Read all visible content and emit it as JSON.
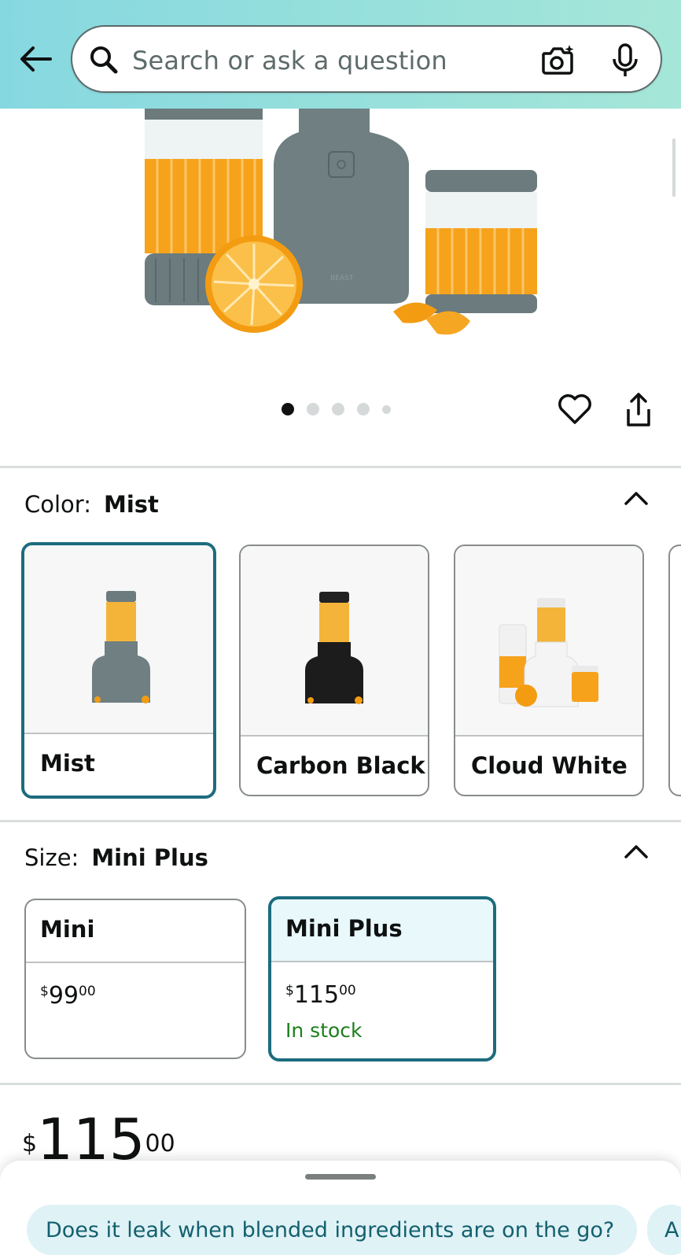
{
  "header": {
    "search_placeholder": "Search or ask a question",
    "icons": [
      "back-arrow-icon",
      "search-icon",
      "camera-icon",
      "microphone-icon"
    ]
  },
  "gallery": {
    "image_count": 5,
    "active_index": 0,
    "product_brand": "BEAST"
  },
  "color": {
    "label": "Color:",
    "selected": "Mist",
    "options": [
      {
        "label": "Mist"
      },
      {
        "label": "Carbon Black"
      },
      {
        "label": "Cloud White"
      }
    ]
  },
  "size": {
    "label": "Size:",
    "selected": "Mini Plus",
    "options": [
      {
        "label": "Mini",
        "price_currency": "$",
        "price_whole": "99",
        "price_cents": "00",
        "stock": ""
      },
      {
        "label": "Mini Plus",
        "price_currency": "$",
        "price_whole": "115",
        "price_cents": "00",
        "stock": "In stock"
      }
    ]
  },
  "price": {
    "currency": "$",
    "whole": "115",
    "cents": "00"
  },
  "suggestions": [
    "Does it leak when blended ingredients are on the go?",
    "A"
  ],
  "colors": {
    "accent": "#1c6c7e",
    "header_gradient_start": "#86d8e0",
    "header_gradient_end": "#a5e6d8",
    "in_stock": "#1d7f1d",
    "chip_bg": "#dff2f6",
    "chip_text": "#13606e"
  }
}
